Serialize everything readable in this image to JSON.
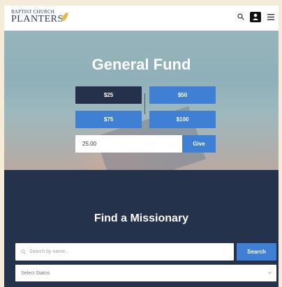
{
  "header": {
    "logo_top": "BAPTIST CHURCH",
    "logo_main": "PLANTERS",
    "icons": [
      "search-icon",
      "user-icon",
      "menu-icon"
    ]
  },
  "hero": {
    "title": "General Fund",
    "amounts": [
      "$25",
      "$50",
      "$75",
      "$100"
    ],
    "selected_amount": "$25",
    "amount_value": "25.00",
    "give_label": "Give"
  },
  "missions": {
    "title": "Find a Missionary",
    "search_placeholder": "Search by name...",
    "search_button": "Search",
    "status_select": "Select Status"
  },
  "colors": {
    "accent": "#3f7fd4",
    "dark_navy": "#25324b",
    "selected_button": "#25304a",
    "logo_gold": "#e4b94a"
  }
}
